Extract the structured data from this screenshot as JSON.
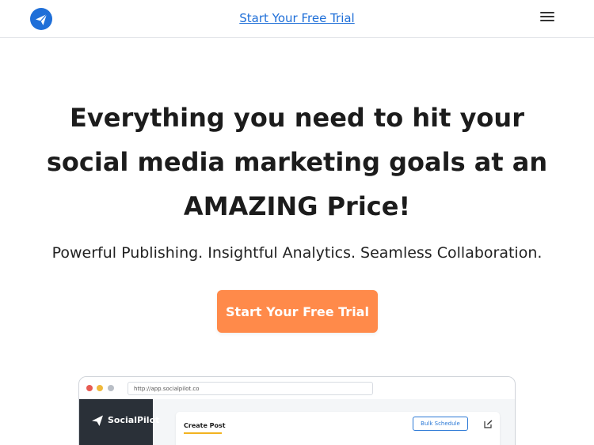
{
  "header": {
    "logo_icon": "paper-plane-icon",
    "cta_link": "Start Your Free Trial",
    "menu_icon": "hamburger-menu-icon"
  },
  "hero": {
    "headline": "Everything you need to hit your social media marketing goals at an AMAZING Price!",
    "subheadline": "Powerful Publishing. Insightful Analytics. Seamless Collaboration.",
    "cta_button": "Start Your Free Trial"
  },
  "mockup": {
    "url": "http://app.socialpilot.co",
    "brand": "SocialPilot",
    "card_title": "Create Post",
    "bulk_button": "Bulk Schedule",
    "edit_icon": "edit-icon"
  },
  "colors": {
    "accent_blue": "#1f6fd8",
    "cta_orange": "#ff8a4a",
    "sidebar_dark": "#2a3038"
  }
}
